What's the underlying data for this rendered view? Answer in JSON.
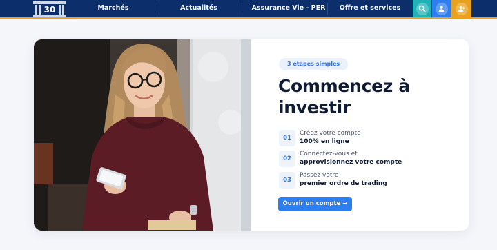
{
  "header": {
    "logo_text": "30",
    "nav": [
      {
        "label": "Marchés"
      },
      {
        "label": "Actualités"
      },
      {
        "label": "Assurance Vie - PER"
      },
      {
        "label": "Offre et services"
      }
    ],
    "buttons": [
      {
        "icon": "search-icon",
        "color": "#1fb3b8"
      },
      {
        "icon": "user-icon",
        "color": "#2e7ef0"
      },
      {
        "icon": "add-user-icon",
        "color": "#e8a21d"
      }
    ]
  },
  "hero": {
    "badge": "3 étapes simples",
    "title": "Commencez à investir",
    "steps": [
      {
        "num": "01",
        "line1": "Créez votre compte",
        "line2": "100% en ligne"
      },
      {
        "num": "02",
        "line1": "Connectez-vous et",
        "line2": "approvisionnez votre compte"
      },
      {
        "num": "03",
        "line1": "Passez votre",
        "line2": "premier ordre de trading"
      }
    ],
    "cta": "Ouvrir un compte →"
  },
  "colors": {
    "nav_bg": "#0c2f6b",
    "accent_orange": "#e8a21d",
    "primary_blue": "#2e7ef0",
    "teal": "#1fb3b8"
  }
}
